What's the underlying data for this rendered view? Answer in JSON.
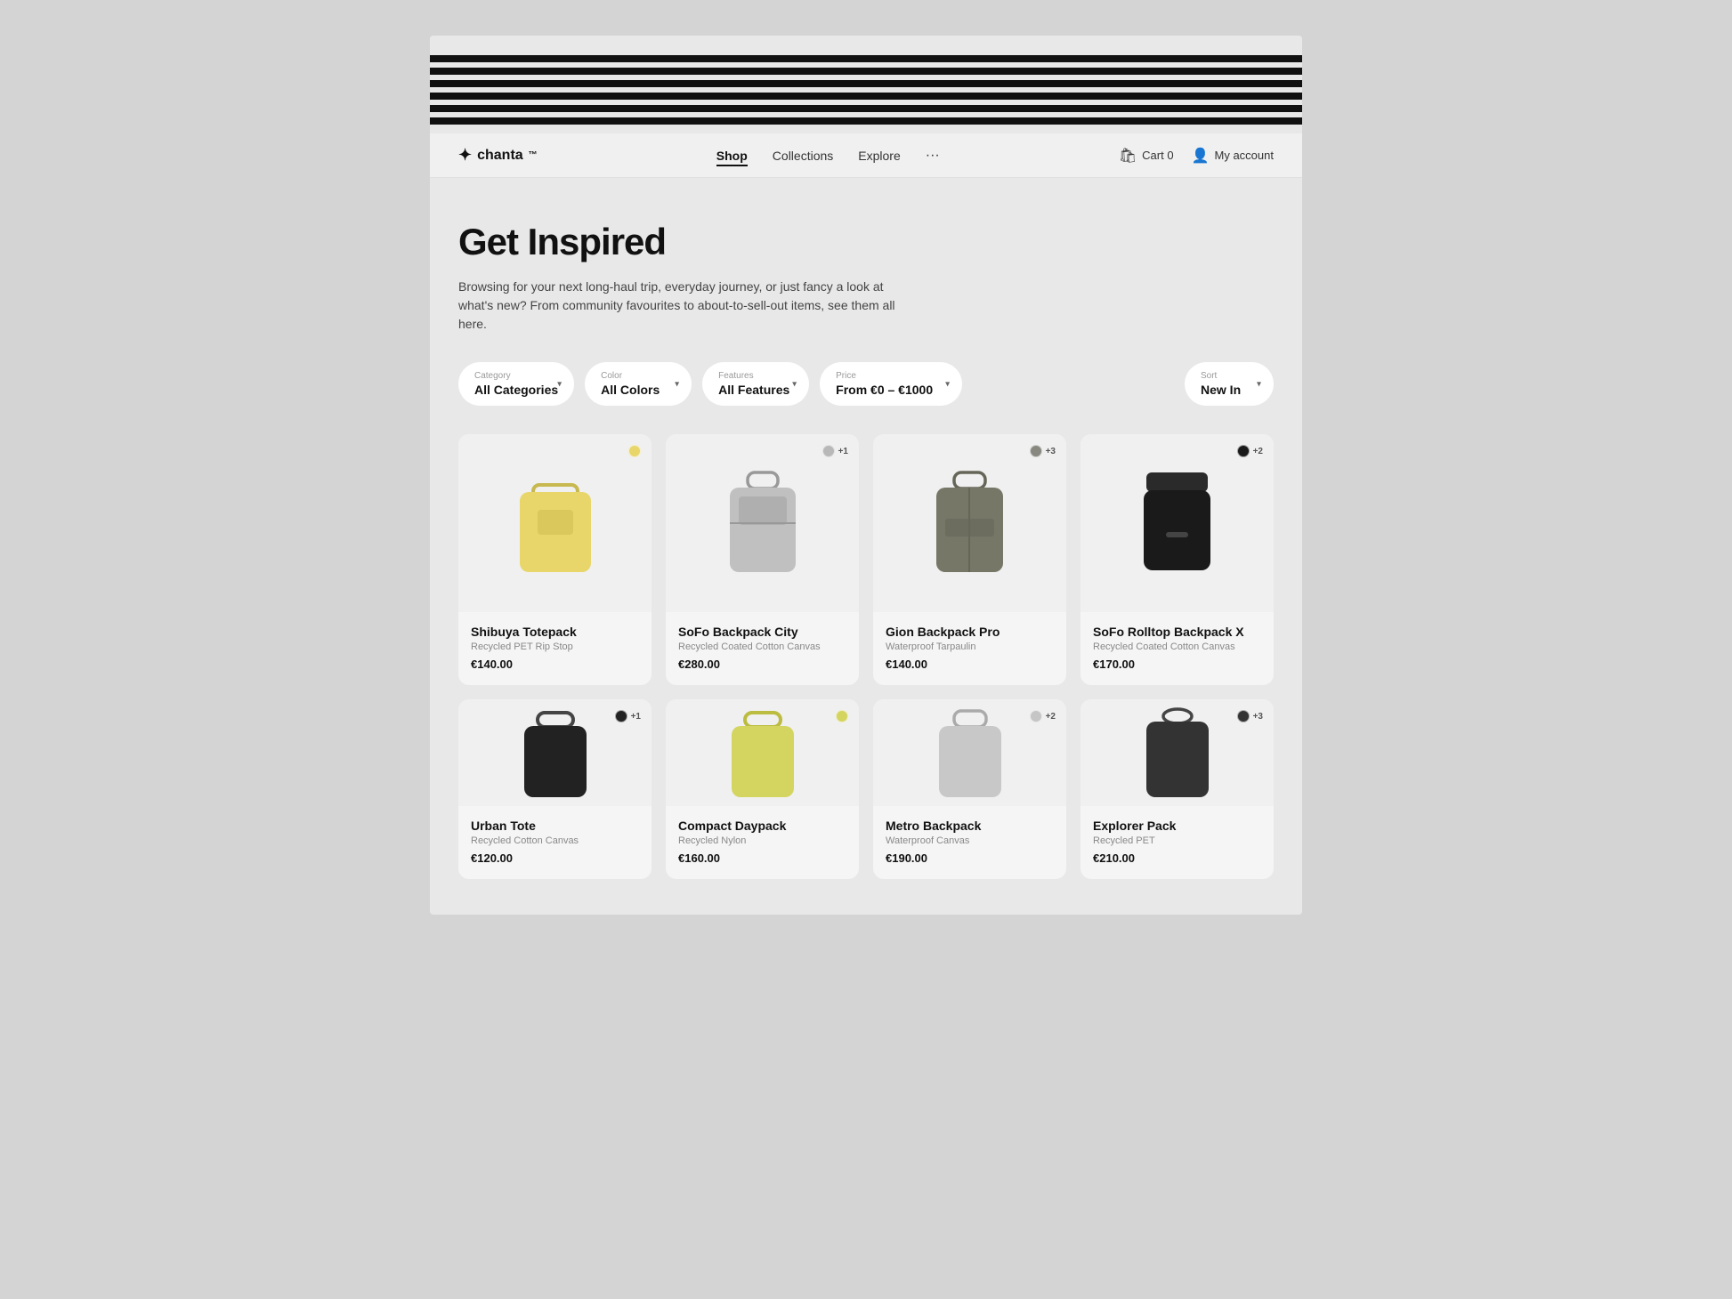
{
  "meta": {
    "brand": "chanta",
    "brand_tm": "™",
    "logo_icon": "✦"
  },
  "nav": {
    "links": [
      {
        "id": "shop",
        "label": "Shop",
        "active": true
      },
      {
        "id": "collections",
        "label": "Collections",
        "active": false
      },
      {
        "id": "explore",
        "label": "Explore",
        "active": false
      },
      {
        "id": "more",
        "label": "···",
        "active": false
      }
    ],
    "cart_label": "Cart 0",
    "account_label": "My account"
  },
  "hero": {
    "title": "Get Inspired",
    "subtitle": "Browsing for your next long-haul trip, everyday journey, or just fancy a look at what's new? From community favourites to about-to-sell-out items, see them all here."
  },
  "filters": {
    "category": {
      "label": "Category",
      "value": "All Categories"
    },
    "color": {
      "label": "Color",
      "value": "All Colors"
    },
    "features": {
      "label": "Features",
      "value": "All Features"
    },
    "price": {
      "label": "Price",
      "value": "From €0 – €1000"
    },
    "sort": {
      "label": "Sort",
      "value": "New In"
    }
  },
  "products": [
    {
      "id": "p1",
      "name": "Shibuya Totepack",
      "material": "Recycled PET Rip Stop",
      "price": "€140.00",
      "color": "#e8d66b",
      "extra_colors": null,
      "extra_count": null,
      "row": 1
    },
    {
      "id": "p2",
      "name": "SoFo Backpack City",
      "material": "Recycled Coated Cotton Canvas",
      "price": "€280.00",
      "color": "#b8b8b8",
      "extra_colors": null,
      "extra_count": "+1",
      "row": 1
    },
    {
      "id": "p3",
      "name": "Gion Backpack Pro",
      "material": "Waterproof Tarpaulin",
      "price": "€140.00",
      "color": "#888880",
      "extra_colors": null,
      "extra_count": "+3",
      "row": 1
    },
    {
      "id": "p4",
      "name": "SoFo Rolltop Backpack X",
      "material": "Recycled Coated Cotton Canvas",
      "price": "€170.00",
      "color": "#1a1a1a",
      "extra_colors": null,
      "extra_count": "+2",
      "row": 1
    },
    {
      "id": "p5",
      "name": "Urban Tote",
      "material": "Recycled Cotton Canvas",
      "price": "€120.00",
      "color": "#222222",
      "extra_colors": null,
      "extra_count": "+1",
      "row": 2
    },
    {
      "id": "p6",
      "name": "Compact Daypack",
      "material": "Recycled Nylon",
      "price": "€160.00",
      "color": "#d4d460",
      "extra_colors": null,
      "extra_count": null,
      "row": 2
    },
    {
      "id": "p7",
      "name": "Metro Backpack",
      "material": "Waterproof Canvas",
      "price": "€190.00",
      "color": "#c5c5c5",
      "extra_colors": null,
      "extra_count": "+2",
      "row": 2
    },
    {
      "id": "p8",
      "name": "Explorer Pack",
      "material": "Recycled PET",
      "price": "€210.00",
      "color": "#333333",
      "extra_colors": null,
      "extra_count": "+3",
      "row": 2
    }
  ]
}
